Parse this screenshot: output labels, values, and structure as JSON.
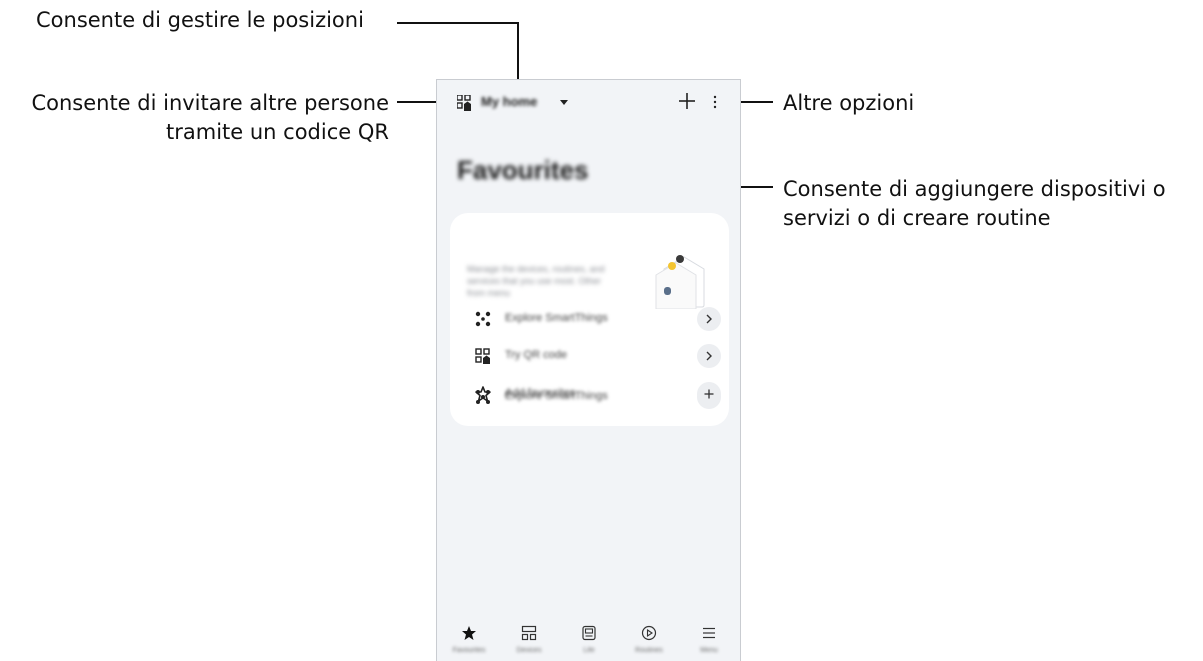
{
  "callouts": {
    "manage_locations": "Consente di gestire le posizioni",
    "invite_qr_line1": "Consente di invitare altre persone",
    "invite_qr_line2": "tramite un codice QR",
    "more_options": "Altre opzioni",
    "add_devices_line1": "Consente di aggiungere dispositivi o",
    "add_devices_line2": "servizi o di creare routine"
  },
  "app": {
    "location_name": "My home",
    "page_title": "Favourites",
    "card_description": "Manage the devices, routines, and services that you use most. Other from menu",
    "rows": [
      {
        "label": "Explore SmartThings",
        "action_icon": "chevron-right-icon"
      },
      {
        "label": "Try QR code",
        "action_icon": "chevron-right-icon"
      },
      {
        "label": "Add favourites",
        "action_icon": "plus-icon"
      }
    ],
    "nav": [
      {
        "label": "Favourites",
        "icon": "star-icon",
        "active": true
      },
      {
        "label": "Devices",
        "icon": "grid-icon",
        "active": false
      },
      {
        "label": "Life",
        "icon": "life-icon",
        "active": false
      },
      {
        "label": "Routines",
        "icon": "play-circle-icon",
        "active": false
      },
      {
        "label": "Menu",
        "icon": "menu-icon",
        "active": false
      }
    ]
  },
  "colors": {
    "screen_bg": "#f2f4f7",
    "card_bg": "#ffffff",
    "text": "#111111"
  }
}
